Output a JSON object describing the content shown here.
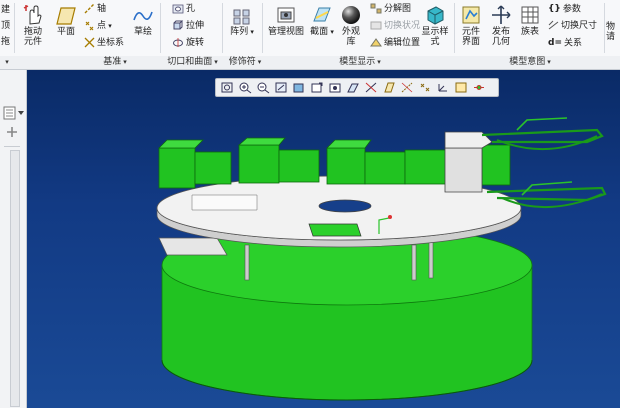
{
  "ribbon": {
    "col0": {
      "top": "建",
      "mid": "顶",
      "bot": "拖"
    },
    "drag_label": "拖动\n元件",
    "plane_label": "平面",
    "axis_label": "轴",
    "point_label": "点",
    "coord_label": "坐标系",
    "sketch_label": "草绘",
    "hole_label": "孔",
    "extrude_label": "拉伸",
    "revolve_label": "旋转",
    "pattern_label": "阵列",
    "view_manager_label": "管理视图",
    "section_label": "截面",
    "appearance_label": "外观\n库",
    "explode_label": "分解图",
    "toggle_status_label": "切换状况",
    "edit_position_label": "编辑位置",
    "display_style_label": "显示样\n式",
    "component_interface_label": "元件\n界面",
    "publish_geom_label": "发布\n几何",
    "family_table_label": "族表",
    "params_label": "参数",
    "toggle_dims_label": "切换尺寸",
    "relations_label": "关系",
    "last_label": "物\n请"
  },
  "groups": {
    "datum": "基准",
    "cut_surface": "切口和曲面",
    "modifier": "修饰符",
    "model_display": "模型显示",
    "model_intent": "模型意图"
  },
  "icons": {
    "drag": "drag-components-icon",
    "plane": "datum-plane-icon",
    "axis": "datum-axis-icon",
    "point": "datum-point-icon",
    "coord": "coordinate-system-icon",
    "sketch": "sketch-icon",
    "hole": "hole-icon",
    "extrude": "extrude-icon",
    "revolve": "revolve-icon",
    "pattern": "pattern-icon",
    "view_manager": "view-manager-icon",
    "section": "section-icon",
    "appearance": "appearance-sphere-icon",
    "display_style": "display-style-cube-icon"
  },
  "colors": {
    "viewport_top": "#0a2a66",
    "viewport_bottom": "#1a4a96",
    "model_green": "#21c321",
    "model_green_dark": "#129a12",
    "plate_white": "#f2f2f2"
  }
}
